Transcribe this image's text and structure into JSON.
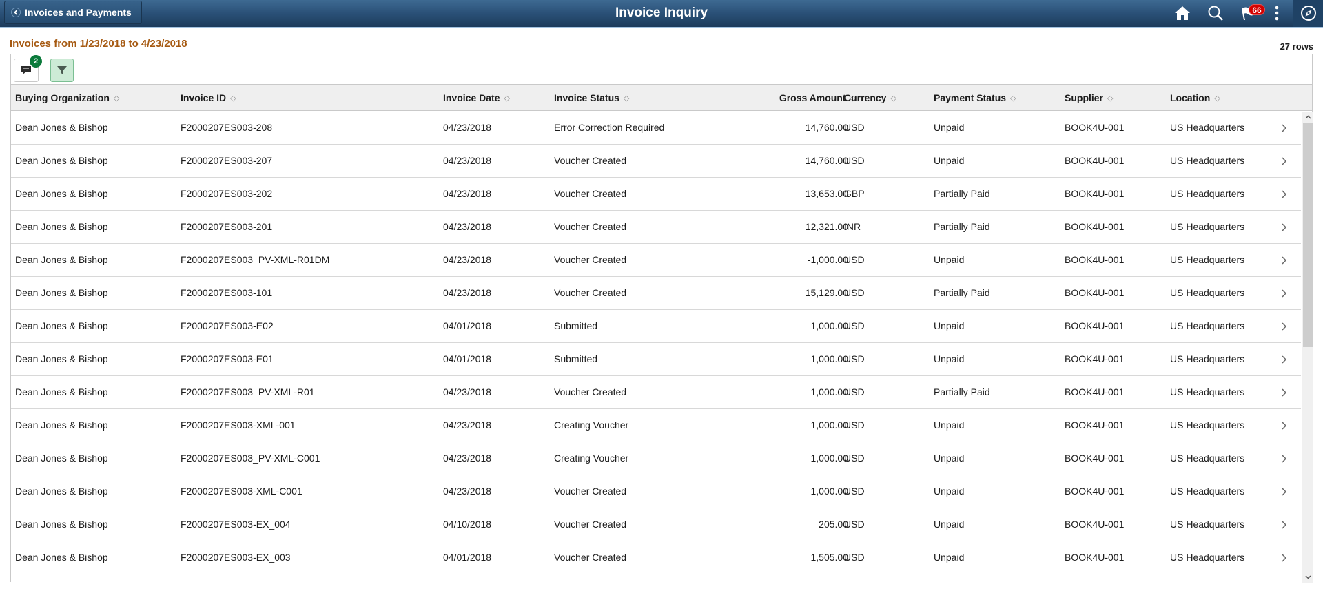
{
  "banner": {
    "back_label": "Invoices and Payments",
    "title": "Invoice Inquiry",
    "icons": [
      "home-icon",
      "search-icon",
      "notifications-flag-icon",
      "actions-menu-icon",
      "navbar-compass-icon"
    ],
    "notification_count": "66"
  },
  "grid": {
    "title": "Invoices from 1/23/2018 to 4/23/2018",
    "row_count": "27 rows",
    "toolbar": {
      "chat_badge": "2",
      "filter_active": true
    },
    "columns": [
      {
        "key": "org",
        "label": "Buying Organization"
      },
      {
        "key": "id",
        "label": "Invoice ID"
      },
      {
        "key": "date",
        "label": "Invoice Date"
      },
      {
        "key": "status",
        "label": "Invoice Status"
      },
      {
        "key": "amount",
        "label": "Gross Amount"
      },
      {
        "key": "currency",
        "label": "Currency"
      },
      {
        "key": "payment",
        "label": "Payment Status"
      },
      {
        "key": "supplier",
        "label": "Supplier"
      },
      {
        "key": "location",
        "label": "Location"
      }
    ],
    "sort_glyph": "◇",
    "rows": [
      {
        "org": "Dean Jones & Bishop",
        "id": "F2000207ES003-208",
        "date": "04/23/2018",
        "status": "Error Correction Required",
        "amount": "14,760.00",
        "currency": "USD",
        "payment": "Unpaid",
        "supplier": "BOOK4U-001",
        "location": "US Headquarters"
      },
      {
        "org": "Dean Jones & Bishop",
        "id": "F2000207ES003-207",
        "date": "04/23/2018",
        "status": "Voucher Created",
        "amount": "14,760.00",
        "currency": "USD",
        "payment": "Unpaid",
        "supplier": "BOOK4U-001",
        "location": "US Headquarters"
      },
      {
        "org": "Dean Jones & Bishop",
        "id": "F2000207ES003-202",
        "date": "04/23/2018",
        "status": "Voucher Created",
        "amount": "13,653.00",
        "currency": "GBP",
        "payment": "Partially Paid",
        "supplier": "BOOK4U-001",
        "location": "US Headquarters"
      },
      {
        "org": "Dean Jones & Bishop",
        "id": "F2000207ES003-201",
        "date": "04/23/2018",
        "status": "Voucher Created",
        "amount": "12,321.00",
        "currency": "INR",
        "payment": "Partially Paid",
        "supplier": "BOOK4U-001",
        "location": "US Headquarters"
      },
      {
        "org": "Dean Jones & Bishop",
        "id": "F2000207ES003_PV-XML-R01DM",
        "date": "04/23/2018",
        "status": "Voucher Created",
        "amount": "-1,000.00",
        "currency": "USD",
        "payment": "Unpaid",
        "supplier": "BOOK4U-001",
        "location": "US Headquarters"
      },
      {
        "org": "Dean Jones & Bishop",
        "id": "F2000207ES003-101",
        "date": "04/23/2018",
        "status": "Voucher Created",
        "amount": "15,129.00",
        "currency": "USD",
        "payment": "Partially Paid",
        "supplier": "BOOK4U-001",
        "location": "US Headquarters"
      },
      {
        "org": "Dean Jones & Bishop",
        "id": "F2000207ES003-E02",
        "date": "04/01/2018",
        "status": "Submitted",
        "amount": "1,000.00",
        "currency": "USD",
        "payment": "Unpaid",
        "supplier": "BOOK4U-001",
        "location": "US Headquarters"
      },
      {
        "org": "Dean Jones & Bishop",
        "id": "F2000207ES003-E01",
        "date": "04/01/2018",
        "status": "Submitted",
        "amount": "1,000.00",
        "currency": "USD",
        "payment": "Unpaid",
        "supplier": "BOOK4U-001",
        "location": "US Headquarters"
      },
      {
        "org": "Dean Jones & Bishop",
        "id": "F2000207ES003_PV-XML-R01",
        "date": "04/23/2018",
        "status": "Voucher Created",
        "amount": "1,000.00",
        "currency": "USD",
        "payment": "Partially Paid",
        "supplier": "BOOK4U-001",
        "location": "US Headquarters"
      },
      {
        "org": "Dean Jones & Bishop",
        "id": "F2000207ES003-XML-001",
        "date": "04/23/2018",
        "status": "Creating Voucher",
        "amount": "1,000.00",
        "currency": "USD",
        "payment": "Unpaid",
        "supplier": "BOOK4U-001",
        "location": "US Headquarters"
      },
      {
        "org": "Dean Jones & Bishop",
        "id": "F2000207ES003_PV-XML-C001",
        "date": "04/23/2018",
        "status": "Creating Voucher",
        "amount": "1,000.00",
        "currency": "USD",
        "payment": "Unpaid",
        "supplier": "BOOK4U-001",
        "location": "US Headquarters"
      },
      {
        "org": "Dean Jones & Bishop",
        "id": "F2000207ES003-XML-C001",
        "date": "04/23/2018",
        "status": "Voucher Created",
        "amount": "1,000.00",
        "currency": "USD",
        "payment": "Unpaid",
        "supplier": "BOOK4U-001",
        "location": "US Headquarters"
      },
      {
        "org": "Dean Jones & Bishop",
        "id": "F2000207ES003-EX_004",
        "date": "04/10/2018",
        "status": "Voucher Created",
        "amount": "205.00",
        "currency": "USD",
        "payment": "Unpaid",
        "supplier": "BOOK4U-001",
        "location": "US Headquarters"
      },
      {
        "org": "Dean Jones & Bishop",
        "id": "F2000207ES003-EX_003",
        "date": "04/01/2018",
        "status": "Voucher Created",
        "amount": "1,505.00",
        "currency": "USD",
        "payment": "Unpaid",
        "supplier": "BOOK4U-001",
        "location": "US Headquarters"
      }
    ],
    "scroll": {
      "position_fraction": 0.0,
      "visible_fraction": 0.5
    }
  },
  "colors": {
    "banner": "#2a5077",
    "grid_title": "#a65a12",
    "badge_red": "#d40000",
    "badge_green": "#0b7a3b",
    "filter_active_bg": "#cdebd6"
  }
}
